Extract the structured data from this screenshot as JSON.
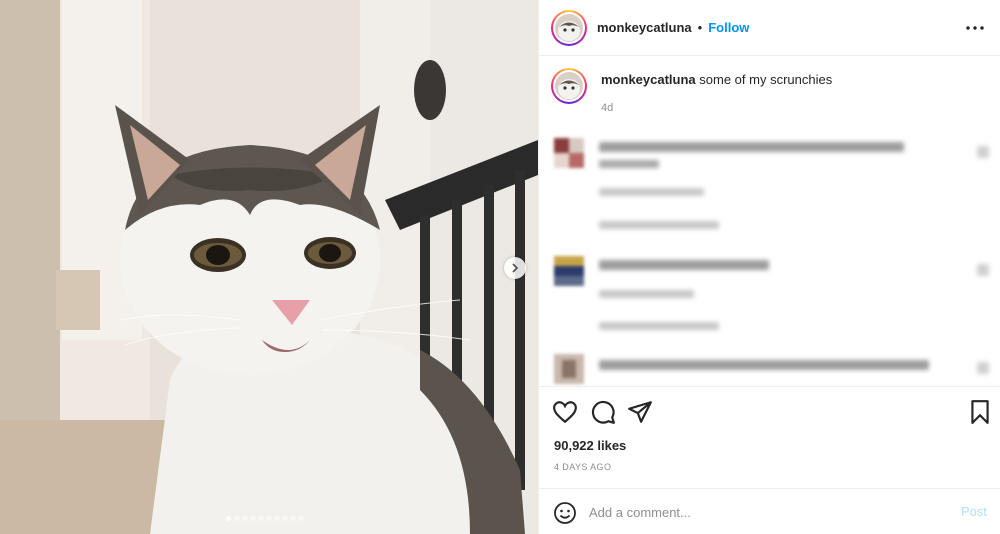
{
  "post": {
    "username": "monkeycatluna",
    "separator": "•",
    "follow_label": "Follow",
    "more_label": "•••",
    "caption_username": "monkeycatluna",
    "caption_text": " some of my scrunchies",
    "caption_time": "4d",
    "likes_text": "90,922 likes",
    "date_text": "4 DAYS AGO"
  },
  "carousel": {
    "slide_count": 10,
    "active_index": 0
  },
  "comment_box": {
    "placeholder": "Add a comment...",
    "post_label": "Post"
  },
  "icons": {
    "like": "heart-icon",
    "comment": "comment-icon",
    "share": "send-icon",
    "save": "bookmark-icon",
    "emoji": "emoji-icon",
    "next": "chevron-right-icon"
  },
  "colors": {
    "link_blue": "#0095f6",
    "post_disabled": "#b2dffc",
    "muted": "#8e8e8e"
  }
}
